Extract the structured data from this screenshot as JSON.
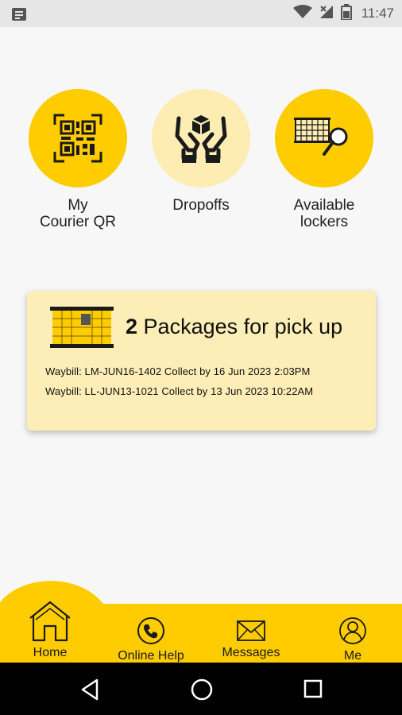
{
  "status_bar": {
    "time": "11:47"
  },
  "actions": [
    {
      "label": "My\nCourier QR",
      "icon": "qr-code-icon"
    },
    {
      "label": "Dropoffs",
      "icon": "hands-package-icon"
    },
    {
      "label": "Available\nlockers",
      "icon": "locker-search-icon"
    }
  ],
  "pickup_card": {
    "count": "2",
    "title": "Packages for pick up",
    "waybills": [
      "Waybill: LM-JUN16-1402 Collect by 16 Jun 2023 2:03PM",
      "Waybill: LL-JUN13-1021 Collect by 13 Jun 2023 10:22AM"
    ]
  },
  "bottom_nav": {
    "items": [
      {
        "label": "Home",
        "icon": "home-icon",
        "active": true
      },
      {
        "label": "Online Help",
        "icon": "phone-icon",
        "active": false
      },
      {
        "label": "Messages",
        "icon": "envelope-icon",
        "active": false
      },
      {
        "label": "Me",
        "icon": "user-icon",
        "active": false
      }
    ]
  },
  "colors": {
    "accent": "#FFCC00",
    "accent_light": "#FDEDB3",
    "card_bg": "#FDEEB7",
    "background": "#F7F7F7"
  }
}
